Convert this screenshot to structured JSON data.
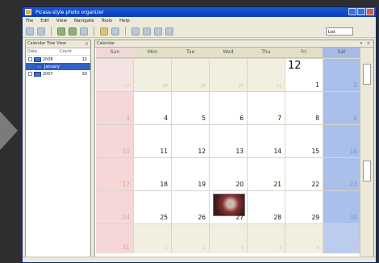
{
  "window": {
    "title": "Picasa-style photo organizer"
  },
  "menu": [
    "File",
    "Edit",
    "View",
    "Navigate",
    "Tools",
    "Help"
  ],
  "toolbar": {
    "select_value": "List"
  },
  "left_panel": {
    "title": "Calendar Tree View",
    "columns": [
      "Date",
      "Count"
    ],
    "items": [
      {
        "label": "2008",
        "count": "12",
        "selected": false,
        "child": false
      },
      {
        "label": "January",
        "count": "",
        "selected": true,
        "child": true
      },
      {
        "label": "2007",
        "count": "30",
        "selected": false,
        "child": false
      }
    ]
  },
  "calendar": {
    "header_label": "Calendar",
    "days_of_week": [
      "Sun",
      "Mon",
      "Tue",
      "Wed",
      "Thu",
      "Fri",
      "Sat"
    ],
    "month_number": "12",
    "weeks": [
      [
        "27",
        "28",
        "29",
        "30",
        "31",
        "1",
        "2"
      ],
      [
        "3",
        "4",
        "5",
        "6",
        "7",
        "8",
        "9"
      ],
      [
        "10",
        "11",
        "12",
        "13",
        "14",
        "15",
        "16"
      ],
      [
        "17",
        "18",
        "19",
        "20",
        "21",
        "22",
        "23"
      ],
      [
        "24",
        "25",
        "26",
        "27",
        "28",
        "29",
        "30"
      ],
      [
        "31",
        "1",
        "2",
        "3",
        "4",
        "5",
        "6"
      ]
    ]
  },
  "colors": {
    "sunday": "#f6d7d7",
    "saturday": "#aac0eb",
    "selection": "#3161c5"
  }
}
